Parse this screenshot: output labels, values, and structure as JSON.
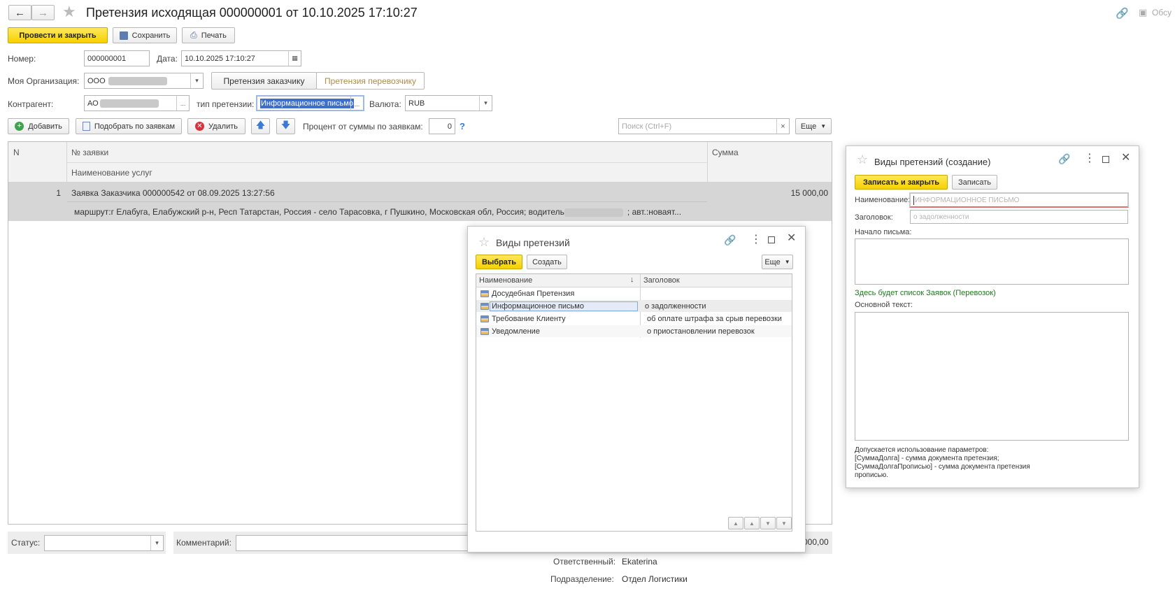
{
  "window": {
    "title": "Претензия исходящая 000000001 от 10.10.2025 17:10:27",
    "top_right_label": "Обсу"
  },
  "toolbar": {
    "post_close": "Провести и закрыть",
    "save": "Сохранить",
    "print": "Печать"
  },
  "form": {
    "number_label": "Номер:",
    "number_value": "000000001",
    "date_label": "Дата:",
    "date_value": "10.10.2025 17:10:27",
    "org_label": "Моя Организация:",
    "org_value": "ООО",
    "tab_customer": "Претензия заказчику",
    "tab_carrier": "Претензия перевозчику",
    "contractor_label": "Контрагент:",
    "contractor_value": "АО",
    "claim_type_label": "тип претензии:",
    "claim_type_value": "Информационное письмо",
    "currency_label": "Валюта:",
    "currency_value": "RUB"
  },
  "table_toolbar": {
    "add": "Добавить",
    "pick": "Подобрать по заявкам",
    "delete": "Удалить",
    "percent_label": "Процент от суммы по заявкам:",
    "percent_value": "0",
    "help": "?",
    "search_placeholder": "Поиск (Ctrl+F)",
    "more": "Еще"
  },
  "table": {
    "col_n": "N",
    "col_order": "№ заявки",
    "col_services": "Наименование услуг",
    "col_sum": "Сумма",
    "rows": [
      {
        "n": "1",
        "order": "Заявка Заказчика 000000542 от 08.09.2025 13:27:56",
        "route_prefix": "маршрут:г Елабуга, Елабужский р-н, Респ Татарстан, Россия - село Тарасовка, г Пушкино, Московская обл, Россия; водитель",
        "route_suffix": "; авт.:новаят...",
        "sum": "15 000,00"
      }
    ]
  },
  "footer": {
    "status_label": "Статус:",
    "comment_label": "Комментарий:",
    "total_partial": "000,00",
    "responsible_label": "Ответственный:",
    "responsible_value": "Ekaterina",
    "department_label": "Подразделение:",
    "department_value": "Отдел Логистики"
  },
  "dialog_list": {
    "title": "Виды претензий",
    "select": "Выбрать",
    "create": "Создать",
    "more": "Еще",
    "col_name": "Наименование",
    "col_header": "Заголовок",
    "rows": [
      {
        "name": "Досудебная Претензия",
        "header": ""
      },
      {
        "name": "Информационное письмо",
        "header": "о задолженности"
      },
      {
        "name": "Требование Клиенту",
        "header": "об оплате штрафа за срыв перевозки"
      },
      {
        "name": "Уведомление",
        "header": "о приостановлении перевозок"
      }
    ]
  },
  "dialog_create": {
    "title": "Виды претензий (создание)",
    "save_close": "Записать и закрыть",
    "save": "Записать",
    "name_label": "Наименование:",
    "name_placeholder": "ИНФОРМАЦИОННОЕ ПИСЬМО",
    "header_label": "Заголовок:",
    "header_placeholder": "о задолженности",
    "start_label": "Начало письма:",
    "orders_note": "Здесь будет список Заявок (Перевозок)",
    "main_text_label": "Основной текст:",
    "params_note_1": "Допускается использование параметров:",
    "params_note_2": "[СуммаДолга] - сумма документа претензия;",
    "params_note_3": "[СуммаДолгаПрописью] - сумма документа претензия",
    "params_note_4": "прописью."
  },
  "colors": {
    "accent_yellow": "#f5d000",
    "selection_blue": "#3d6fc9",
    "link_green": "#1f7a1f"
  }
}
